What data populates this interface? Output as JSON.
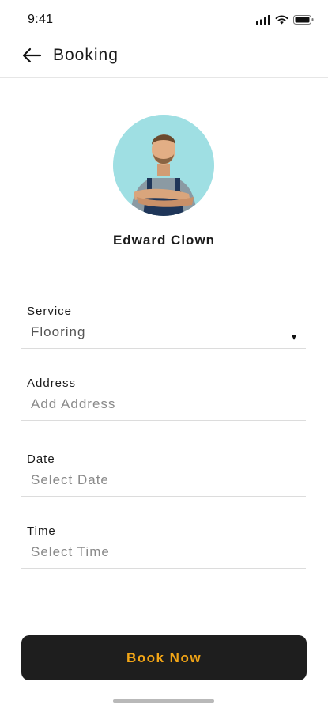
{
  "status_bar": {
    "time": "9:41",
    "icons": [
      "signal-icon",
      "wifi-icon",
      "battery-icon"
    ]
  },
  "header": {
    "title": "Booking",
    "back_icon": "arrow-left-icon"
  },
  "profile": {
    "name": "Edward Clown",
    "avatar_bg": "#9fdfe3"
  },
  "form": {
    "service": {
      "label": "Service",
      "value": "Flooring",
      "caret": "▾"
    },
    "address": {
      "label": "Address",
      "placeholder": "Add Address"
    },
    "date": {
      "label": "Date",
      "placeholder": "Select Date"
    },
    "time": {
      "label": "Time",
      "placeholder": "Select Time"
    }
  },
  "actions": {
    "book_now": "Book Now",
    "button_bg": "#1e1e1e",
    "button_text_color": "#f2a516"
  }
}
